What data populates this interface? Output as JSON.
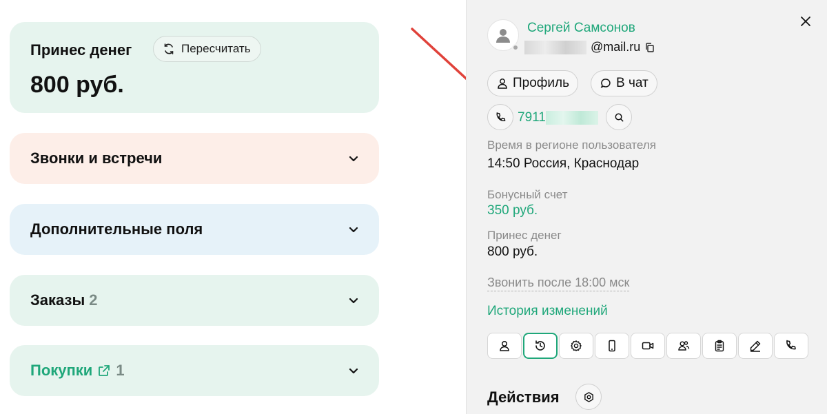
{
  "money_card": {
    "title": "Принес денег",
    "recalc_label": "Пересчитать",
    "value": "800 руб."
  },
  "accordions": {
    "calls": {
      "title": "Звонки и встречи"
    },
    "fields": {
      "title": "Дополнительные поля"
    },
    "orders": {
      "title": "Заказы",
      "count": "2"
    },
    "purchases": {
      "title": "Покупки",
      "count": "1"
    }
  },
  "panel": {
    "user_name": "Сергей Самсонов",
    "email_suffix": "@mail.ru",
    "profile_label": "Профиль",
    "chat_label": "В чат",
    "phone_prefix": "7911",
    "time_label": "Время в регионе пользователя",
    "time_value": "14:50  Россия, Краснодар",
    "bonus_label": "Бонусный счет",
    "bonus_value": "350 руб.",
    "money_label": "Принес денег",
    "money_value": "800 руб.",
    "note": "Звонить после 18:00 мск",
    "history_link": "История изменений",
    "actions_title": "Действия"
  },
  "colors": {
    "accent": "#1fa77a",
    "arrow": "#e0423a"
  },
  "tool_icons": [
    "user-icon",
    "history-icon",
    "settings-icon",
    "mobile-icon",
    "video-icon",
    "users-icon",
    "clipboard-icon",
    "pen-icon",
    "phone-icon"
  ]
}
